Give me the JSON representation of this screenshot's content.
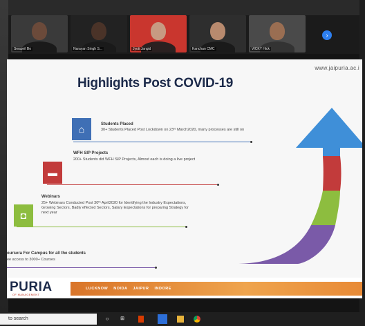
{
  "meeting": {
    "participants": [
      {
        "name": "Swapnil Bo",
        "bg": "#3a3a3a"
      },
      {
        "name": "Narayan Singh S...",
        "bg": "#262626"
      },
      {
        "name": "Jyoti Jangid",
        "bg": "#c9362e"
      },
      {
        "name": "Kanchan CMC",
        "bg": "#303030"
      },
      {
        "name": "VICKY Hick",
        "bg": "#444"
      }
    ],
    "next_icon": "chevron-right-icon"
  },
  "slide": {
    "url": "www.jaipuria.ac.i",
    "title": "Highlights Post COVID-19",
    "items": [
      {
        "icon": "home-icon",
        "color": "#3f6fb5",
        "heading": "Students Placed",
        "description": "30+ Students Placed Post Lockdown on 23ʳᵈ March2020, many processes are still on"
      },
      {
        "icon": "chat-icon",
        "color": "#c23b3b",
        "heading": "WFH SIP Projects",
        "description": "200+ Students did WFH SIP Projects, Almost each is doing a live project"
      },
      {
        "icon": "camera-icon",
        "color": "#8dbd3f",
        "heading": "Webinars",
        "description": "25+ Webinars Conducted Post 30ᵗʰ April2020 for Identifying the Industry Expectations, Growing Sectors, Badly effected Sectors, Salary Expectations for preparing Strategy for next year"
      },
      {
        "icon": "",
        "color": "#7a5aa8",
        "heading": "oursera For Campus for all the students",
        "description": "ee access to 3000+ Courses"
      }
    ],
    "arrow_colors": [
      "#7a5aa8",
      "#8dbd3f",
      "#c23b3b",
      "#3f8fd8"
    ],
    "footer": {
      "brand": "PURIA",
      "brand_sub": "OF MANAGEMENT",
      "cities": "LUCKNOW NOIDA JAIPUR INDORE"
    }
  },
  "taskbar": {
    "search_placeholder": "to search",
    "icons": [
      "cortana-icon",
      "task-view-icon",
      "office-icon",
      "app-icon",
      "file-explorer-icon",
      "chrome-icon"
    ]
  }
}
